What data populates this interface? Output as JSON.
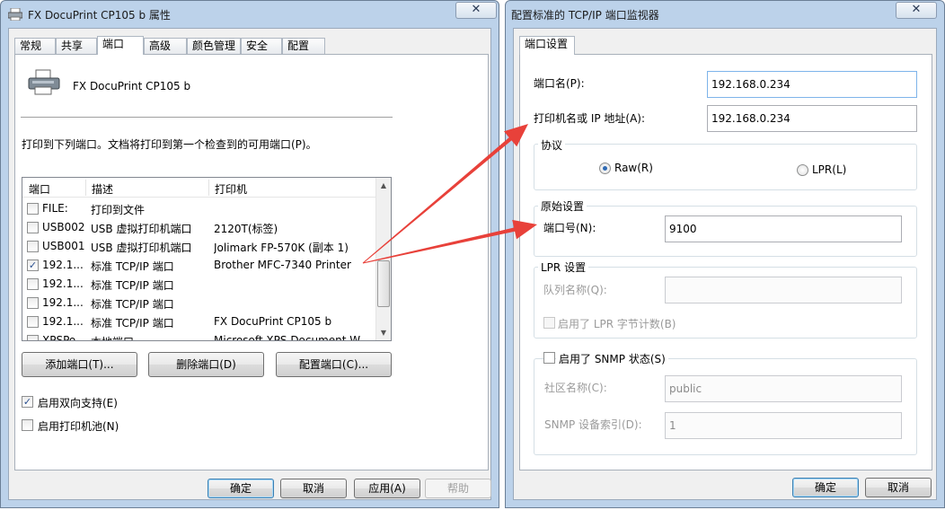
{
  "win1": {
    "title": "FX DocuPrint CP105 b 属性",
    "close_label": "✕",
    "tabs": [
      "常规",
      "共享",
      "端口",
      "高级",
      "颜色管理",
      "安全",
      "配置"
    ],
    "printer_name": "FX DocuPrint CP105 b",
    "instruction": "打印到下列端口。文档将打印到第一个检查到的可用端口(P)。",
    "columns": [
      "端口",
      "描述",
      "打印机"
    ],
    "rows": [
      {
        "port": "FILE:",
        "desc": "打印到文件",
        "printer": "",
        "checked": false
      },
      {
        "port": "USB002",
        "desc": "USB 虚拟打印机端口",
        "printer": "2120T(标签)",
        "checked": false
      },
      {
        "port": "USB001",
        "desc": "USB 虚拟打印机端口",
        "printer": "Jolimark FP-570K (副本 1)",
        "checked": false
      },
      {
        "port": "192.1...",
        "desc": "标准 TCP/IP 端口",
        "printer": "Brother MFC-7340 Printer",
        "checked": true
      },
      {
        "port": "192.1...",
        "desc": "标准 TCP/IP 端口",
        "printer": "",
        "checked": false
      },
      {
        "port": "192.1...",
        "desc": "标准 TCP/IP 端口",
        "printer": "",
        "checked": false
      },
      {
        "port": "192.1...",
        "desc": "标准 TCP/IP 端口",
        "printer": "FX DocuPrint CP105 b",
        "checked": false
      },
      {
        "port": "XPSPo...",
        "desc": "本地端口",
        "printer": "Microsoft XPS Document W...",
        "checked": false
      }
    ],
    "add_port": "添加端口(T)...",
    "delete_port": "删除端口(D)",
    "config_port": "配置端口(C)...",
    "bidi_label": "启用双向支持(E)",
    "bidi_checked": true,
    "pool_label": "启用打印机池(N)",
    "pool_checked": false,
    "ok": "确定",
    "cancel": "取消",
    "apply": "应用(A)",
    "help": "帮助"
  },
  "win2": {
    "title": "配置标准的 TCP/IP 端口监视器",
    "close_label": "✕",
    "tab": "端口设置",
    "port_name_label": "端口名(P):",
    "port_name_value": "192.168.0.234",
    "host_label": "打印机名或 IP 地址(A):",
    "host_value": "192.168.0.234",
    "protocol_title": "协议",
    "raw_label": "Raw(R)",
    "lpr_label": "LPR(L)",
    "protocol_selected": "Raw",
    "raw_settings_title": "原始设置",
    "port_number_label": "端口号(N):",
    "port_number_value": "9100",
    "lpr_settings_title": "LPR 设置",
    "queue_label": "队列名称(Q):",
    "queue_value": "",
    "byte_count_label": "启用了 LPR 字节计数(B)",
    "snmp_label": "启用了 SNMP 状态(S)",
    "community_label": "社区名称(C):",
    "community_value": "public",
    "device_index_label": "SNMP 设备索引(D):",
    "device_index_value": "1",
    "ok": "确定",
    "cancel": "取消"
  },
  "colors": {
    "arrow": "#e8413a",
    "window_frame": "#bcd2ea"
  }
}
